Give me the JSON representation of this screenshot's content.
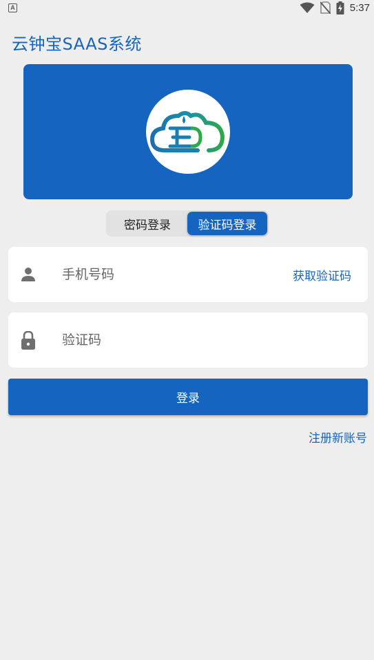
{
  "status_bar": {
    "notification_icon": "A",
    "time": "5:37",
    "icons": [
      "wifi-icon",
      "no-sim-icon",
      "battery-charging-icon"
    ]
  },
  "app": {
    "title": "云钟宝SAAS系统"
  },
  "login_mode": {
    "tabs": [
      {
        "label": "密码登录",
        "active": false
      },
      {
        "label": "验证码登录",
        "active": true
      }
    ]
  },
  "phone": {
    "placeholder": "手机号码",
    "value": "",
    "get_code_label": "获取验证码"
  },
  "code": {
    "placeholder": "验证码",
    "value": ""
  },
  "actions": {
    "login_label": "登录",
    "register_label": "注册新账号"
  },
  "colors": {
    "primary": "#1565c0",
    "background": "#eeeeee",
    "logo_blue": "#1a7fb0",
    "logo_green": "#2ea84a"
  }
}
